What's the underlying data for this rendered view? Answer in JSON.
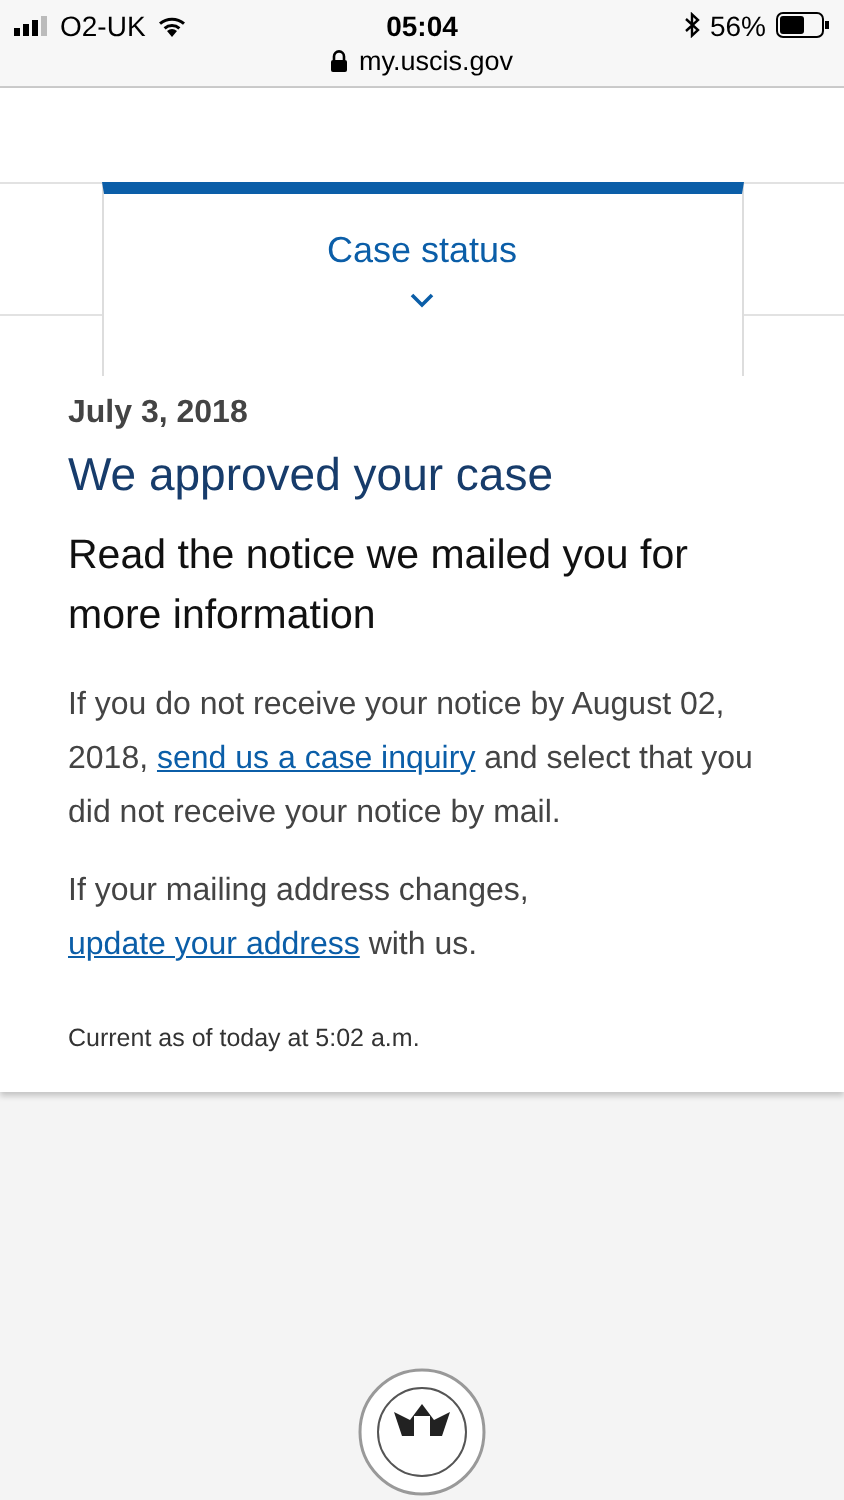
{
  "status_bar": {
    "carrier": "O2-UK",
    "time": "05:04",
    "battery": "56%"
  },
  "address_bar": {
    "url": "my.uscis.gov"
  },
  "tab": {
    "label": "Case status",
    "expanded": true
  },
  "case": {
    "date": "July 3, 2018",
    "title": "We approved your case",
    "subtitle": "Read the notice we mailed you for more information",
    "paragraphs": [
      {
        "before": "If you do not receive your notice by August 02, 2018, ",
        "link": "send us a case inquiry",
        "after": " and select that you did not receive your notice by mail."
      },
      {
        "before": "If your mailing address changes, ",
        "link": "update your address",
        "after": " with us."
      }
    ],
    "updated": "Current as of today at 5:02 a.m."
  }
}
